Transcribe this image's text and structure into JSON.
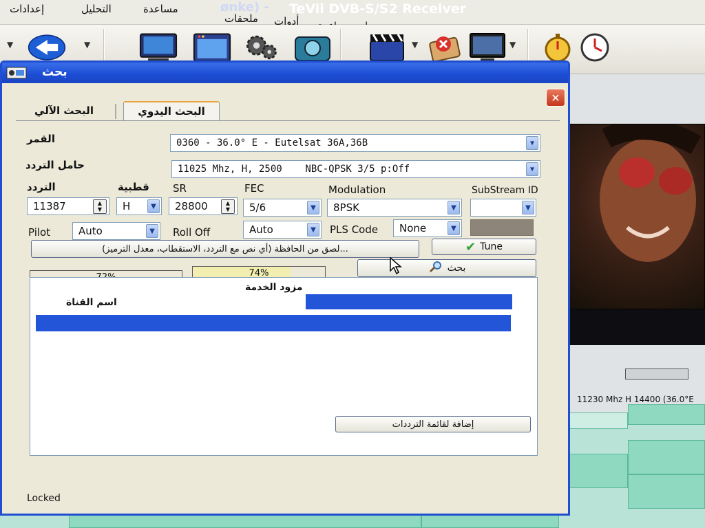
{
  "app": {
    "title_prefix": "ønke) -",
    "title": "TeVii DVB-S/S2 Receiver",
    "menu": [
      "إعدادات",
      "التحليل",
      "مساعدة",
      "ملحقات",
      "أدوات"
    ],
    "submenu": "برامج مساعدة",
    "status_freq": "11230 Mhz  H  14400  (36.0°E"
  },
  "dialog": {
    "title": "بحث",
    "close_label": "✕",
    "tabs": [
      {
        "label": "البحث الآلي"
      },
      {
        "label": "البحث اليدوي"
      }
    ],
    "satellite": {
      "label": "القمر",
      "value": "0360 - 36.0° E - Eutelsat 36A,36B"
    },
    "transponder": {
      "label": "حامل التردد",
      "value": "11025 Mhz, H, 2500    NBC-QPSK 3/5 p:Off"
    },
    "frequency": {
      "label": "التردد",
      "value": "11387"
    },
    "polarity": {
      "label": "قطبية",
      "value": "H"
    },
    "sr": {
      "label": "SR",
      "value": "28800"
    },
    "fec": {
      "label": "FEC",
      "value": "5/6"
    },
    "modulation": {
      "label": "Modulation",
      "value": "8PSK"
    },
    "substream": {
      "label": "SubStream ID",
      "value": ""
    },
    "pilot": {
      "label": "Pilot",
      "value": "Auto"
    },
    "rolloff": {
      "label": "Roll Off",
      "value": "Auto"
    },
    "pls_code": {
      "label": "PLS Code",
      "value": "None"
    },
    "paste_button": "...لصق من الحافظة (أي نص مع التردد، الاستقطاب، معدل الترميز)",
    "tune_button": "Tune",
    "search_button": "بحث",
    "signal_strength": {
      "text": "72%",
      "value": 72
    },
    "signal_quality": {
      "text": "74%",
      "value": 74
    },
    "list_columns": {
      "provider": "مزود الخدمة",
      "channel_name": "اسم القناة"
    },
    "add_button": "إضافة لقائمة الترددات",
    "status": "Locked"
  },
  "colors": {
    "title_blue": "#1d4ed6",
    "select_blue": "#2255d8",
    "tune_check": "#2e9e2e",
    "quality_fill": "#f1eeb0"
  },
  "icons": [
    "back-arrow-icon",
    "tv-icon",
    "screen-icon",
    "gear-icon",
    "camera-icon",
    "clapper-icon",
    "delete-icon",
    "monitor-icon",
    "stopwatch-icon",
    "clock-icon",
    "check-icon",
    "magnifier-icon"
  ]
}
